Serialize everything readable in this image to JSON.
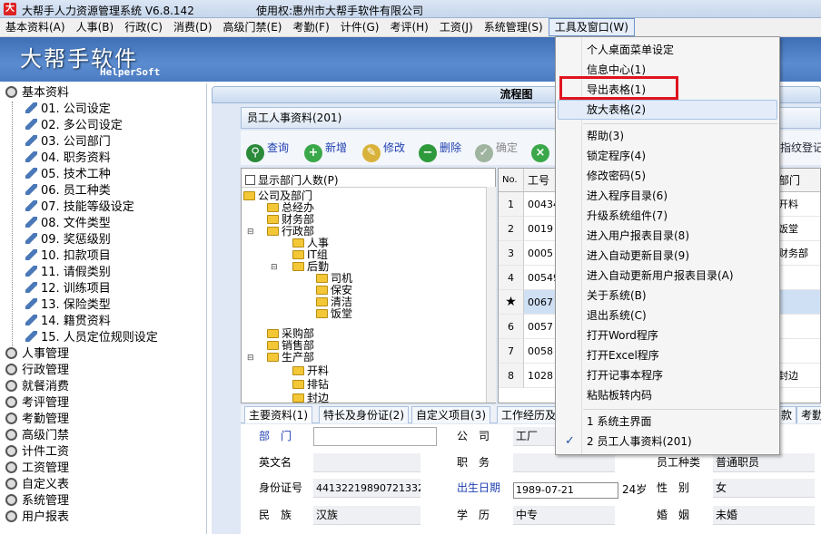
{
  "window": {
    "title": "大帮手人力资源管理系统 V6.8.142",
    "license": "使用权:惠州市大帮手软件有限公司",
    "icon_letter": "大"
  },
  "menubar": [
    "基本资料(A)",
    "人事(B)",
    "行政(C)",
    "消费(D)",
    "高级门禁(E)",
    "考勤(F)",
    "计件(G)",
    "考评(H)",
    "工资(J)",
    "系统管理(S)",
    "工具及窗口(W)"
  ],
  "banner": {
    "logo_cn": "大帮手软件",
    "logo_en": "HelperSoft"
  },
  "left_tree": {
    "root_expanded": "基本资料",
    "children": [
      "01. 公司设定",
      "02. 多公司设定",
      "03. 公司部门",
      "04. 职务资料",
      "05. 技术工种",
      "06. 员工种类",
      "07. 技能等级设定",
      "08. 文件类型",
      "09. 奖惩级别",
      "10. 扣款项目",
      "11. 请假类别",
      "12. 训练项目",
      "13. 保险类型",
      "14. 籍贯资料",
      "15. 人员定位规则设定"
    ],
    "other_roots": [
      "人事管理",
      "行政管理",
      "就餐消费",
      "考评管理",
      "考勤管理",
      "高级门禁",
      "计件工资",
      "工资管理",
      "自定义表",
      "系统管理",
      "用户报表"
    ]
  },
  "flow_title": "流程图",
  "employee_window": {
    "title": "员工人事资料(201)",
    "toolbar": {
      "query": "查询",
      "add": "新增",
      "edit": "修改",
      "delete": "删除",
      "confirm": "确定"
    },
    "toolbar_right_text": "指纹登记",
    "show_dept_count": "显示部门人数(P)",
    "dept_tree": [
      "公司及部门",
      "总经办",
      "财务部",
      "行政部",
      "人事",
      "IT组",
      "后勤",
      "司机",
      "保安",
      "清洁",
      "饭堂",
      "采购部",
      "销售部",
      "生产部",
      "开料",
      "排钻",
      "封边"
    ],
    "grid": {
      "headers": [
        "No.",
        "工号",
        "部门"
      ],
      "rows": [
        {
          "no": "1",
          "id": "00434",
          "dept": "开料"
        },
        {
          "no": "2",
          "id": "0019",
          "dept": "饭堂"
        },
        {
          "no": "3",
          "id": "0005",
          "dept": "财务部"
        },
        {
          "no": "4",
          "id": "00549",
          "dept": ""
        },
        {
          "no": "★",
          "id": "0067",
          "dept": ""
        },
        {
          "no": "6",
          "id": "0057",
          "dept": ""
        },
        {
          "no": "7",
          "id": "0058",
          "dept": ""
        },
        {
          "no": "8",
          "id": "1028",
          "dept": "封边"
        }
      ]
    },
    "tabs": [
      "主要资料(1)",
      "特长及身份证(2)",
      "自定义项目(3)",
      "工作经历及",
      "款",
      "考勤"
    ],
    "form": {
      "dept_label": "部　门",
      "company_label": "公　司",
      "company_value": "工厂",
      "english_name_label": "英文名",
      "position_label": "职　务",
      "id_label": "身份证号",
      "id_value": "441322198907213324",
      "birth_label": "出生日期",
      "birth_value": "1989-07-21",
      "age_value": "24岁",
      "nation_label": "民　族",
      "nation_value": "汉族",
      "education_label": "学　历",
      "education_value": "中专",
      "emp_type_label": "员工种类",
      "emp_type_value": "普通职员",
      "gender_label": "性　别",
      "gender_value": "女",
      "marriage_label": "婚　姻",
      "marriage_value": "未婚"
    }
  },
  "dropdown": {
    "items": [
      "个人桌面菜单设定",
      "信息中心(1)",
      "导出表格(1)",
      "放大表格(2)",
      "帮助(3)",
      "锁定程序(4)",
      "修改密码(5)",
      "进入程序目录(6)",
      "升级系统组件(7)",
      "进入用户报表目录(8)",
      "进入自动更新目录(9)",
      "进入自动更新用户报表目录(A)",
      "关于系统(B)",
      "退出系统(C)",
      "打开Word程序",
      "打开Excel程序",
      "打开记事本程序",
      "粘贴板转内码",
      "1 系统主界面",
      "2 员工人事资料(201)"
    ],
    "checkmark": "✓"
  },
  "colors": {
    "highlight": "#e0141e",
    "banner": "#4a7bc2",
    "selected_row": "#cfe0f5"
  }
}
